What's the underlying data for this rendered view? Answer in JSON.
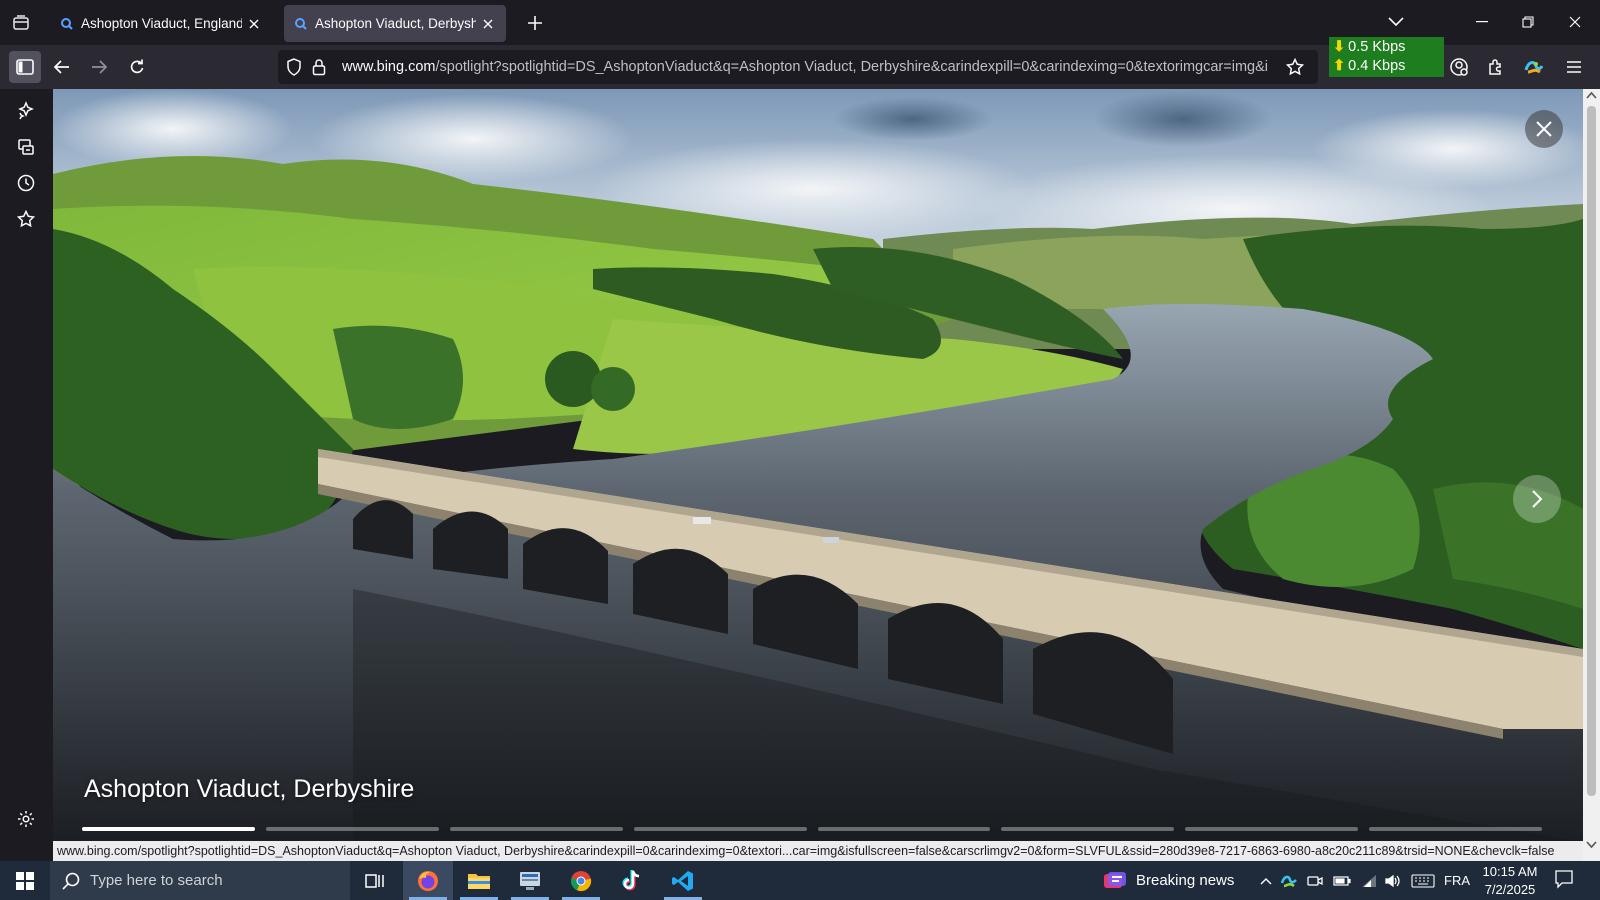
{
  "browser": {
    "tabs": [
      {
        "title": "Ashopton Viaduct, England - Search",
        "active": false
      },
      {
        "title": "Ashopton Viaduct, Derbyshire - Bing",
        "active": true
      }
    ],
    "url_domain": "www.bing.com",
    "url_path": "/spotlight?spotlightid=DS_AshoptonViaduct&q=Ashopton Viaduct, Derbyshire&carindexpill=0&carindeximg=0&textorimgcar=img&isfullscreen=false",
    "network_speed": {
      "download": "0.5 Kbps",
      "upload": "0.4 Kbps"
    },
    "status_url": "www.bing.com/spotlight?spotlightid=DS_AshoptonViaduct&q=Ashopton Viaduct, Derbyshire&carindexpill=0&carindeximg=0&textori...car=img&isfullscreen=false&carscrlimgv2=0&form=SLVFUL&ssid=280d39e8-7217-6863-6980-a8c20c211c89&trsid=NONE&chevclk=false"
  },
  "spotlight": {
    "caption": "Ashopton Viaduct, Derbyshire",
    "slides_total": 8,
    "current_slide": 1
  },
  "taskbar": {
    "search_placeholder": "Type here to search",
    "news_label": "Breaking news",
    "language": "FRA",
    "time": "10:15 AM",
    "date": "7/2/2025"
  },
  "colors": {
    "accent_speed_bg": "#1e7d1e",
    "tab_active_bg": "#42414d",
    "taskbar_bg": "#1f2b3b"
  }
}
